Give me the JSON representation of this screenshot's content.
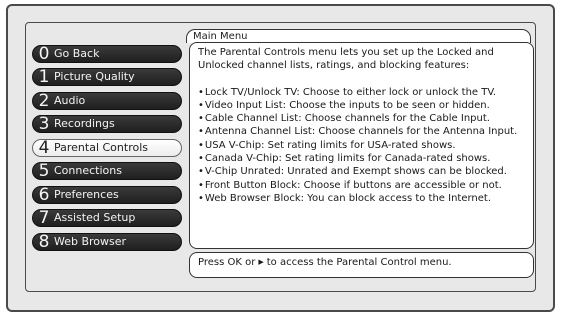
{
  "menu": {
    "title": "Main Menu",
    "items": [
      {
        "num": "0",
        "label": "Go Back",
        "selected": false
      },
      {
        "num": "1",
        "label": "Picture Quality",
        "selected": false
      },
      {
        "num": "2",
        "label": "Audio",
        "selected": false
      },
      {
        "num": "3",
        "label": "Recordings",
        "selected": false
      },
      {
        "num": "4",
        "label": "Parental Controls",
        "selected": true
      },
      {
        "num": "5",
        "label": "Connections",
        "selected": false
      },
      {
        "num": "6",
        "label": "Preferences",
        "selected": false
      },
      {
        "num": "7",
        "label": "Assisted Setup",
        "selected": false
      },
      {
        "num": "8",
        "label": "Web Browser",
        "selected": false
      }
    ]
  },
  "description": {
    "intro": "The Parental Controls menu lets you set up the Locked and Unlocked channel lists, ratings, and blocking features:",
    "features": [
      "Lock TV/Unlock TV: Choose to either lock or unlock the TV.",
      "Video Input List: Choose the inputs to be seen or hidden.",
      "Cable Channel List: Choose channels for the Cable Input.",
      "Antenna Channel List: Choose channels for the Antenna Input.",
      "USA V-Chip: Set rating limits for USA-rated shows.",
      "Canada V-Chip: Set rating limits for Canada-rated shows.",
      "V-Chip Unrated: Unrated and Exempt shows can be blocked.",
      "Front Button Block: Choose if buttons are accessible or not.",
      "Web Browser Block: You can block access to the Internet."
    ]
  },
  "hint": {
    "before": "Press OK or",
    "icon": "right-triangle-icon",
    "after": "to access the Parental Control menu."
  }
}
